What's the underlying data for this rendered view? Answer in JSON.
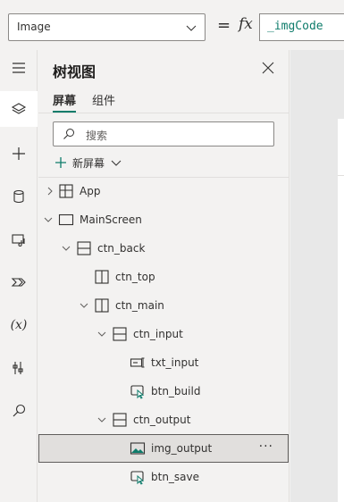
{
  "formula_bar": {
    "property": "Image",
    "equals": "=",
    "fx": "fx",
    "formula": "_imgCode"
  },
  "rail": {
    "items": [
      {
        "icon": "hamburger-icon"
      },
      {
        "icon": "layers-icon",
        "active": true
      },
      {
        "icon": "plus-icon"
      },
      {
        "icon": "database-icon"
      },
      {
        "icon": "media-icon"
      },
      {
        "icon": "power-automate-icon"
      },
      {
        "icon": "variable-icon",
        "text": "(x)"
      },
      {
        "icon": "tools-icon"
      },
      {
        "icon": "search-icon"
      }
    ]
  },
  "panel": {
    "title": "树视图",
    "tabs": [
      "屏幕",
      "组件"
    ],
    "search_placeholder": "搜索",
    "new_screen": "新屏幕",
    "tree": [
      {
        "label": "App",
        "icon": "app-icon",
        "expanded": false
      },
      {
        "label": "MainScreen",
        "icon": "screen-icon",
        "expanded": true
      },
      {
        "label": "ctn_back",
        "icon": "vertical-container-icon",
        "expanded": true
      },
      {
        "label": "ctn_top",
        "icon": "horizontal-container-icon",
        "expanded": false
      },
      {
        "label": "ctn_main",
        "icon": "horizontal-container-icon",
        "expanded": true
      },
      {
        "label": "ctn_input",
        "icon": "vertical-container-icon",
        "expanded": true
      },
      {
        "label": "txt_input",
        "icon": "text-input-icon"
      },
      {
        "label": "btn_build",
        "icon": "button-icon"
      },
      {
        "label": "ctn_output",
        "icon": "vertical-container-icon",
        "expanded": true
      },
      {
        "label": "img_output",
        "icon": "image-icon",
        "selected": true,
        "more": "···"
      },
      {
        "label": "btn_save",
        "icon": "button-icon"
      }
    ]
  }
}
